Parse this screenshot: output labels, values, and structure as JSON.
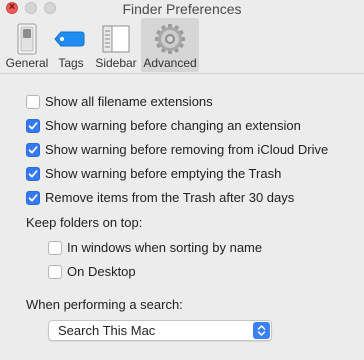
{
  "window": {
    "title": "Finder Preferences"
  },
  "toolbar": {
    "tabs": [
      {
        "label": "General",
        "icon": "switch-icon"
      },
      {
        "label": "Tags",
        "icon": "tag-icon"
      },
      {
        "label": "Sidebar",
        "icon": "sidebar-icon"
      },
      {
        "label": "Advanced",
        "icon": "gear-icon"
      }
    ],
    "selected": "Advanced"
  },
  "options": [
    {
      "label": "Show all filename extensions",
      "checked": false
    },
    {
      "label": "Show warning before changing an extension",
      "checked": true
    },
    {
      "label": "Show warning before removing from iCloud Drive",
      "checked": true
    },
    {
      "label": "Show warning before emptying the Trash",
      "checked": true
    },
    {
      "label": "Remove items from the Trash after 30 days",
      "checked": true
    }
  ],
  "keep_folders": {
    "heading": "Keep folders on top:",
    "options": [
      {
        "label": "In windows when sorting by name",
        "checked": false
      },
      {
        "label": "On Desktop",
        "checked": false
      }
    ]
  },
  "search": {
    "heading": "When performing a search:",
    "value": "Search This Mac"
  },
  "colors": {
    "accent": "#3478f6",
    "close": "#ee5b55",
    "background": "#ececec"
  }
}
